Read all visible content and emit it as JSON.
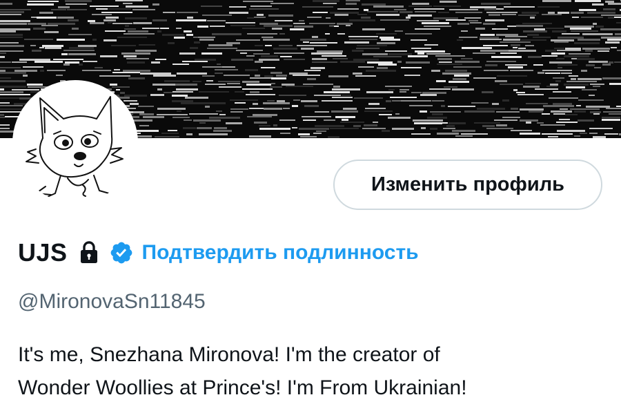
{
  "profile": {
    "display_name": "UJS",
    "verify_link_label": "Подтвердить подлинность",
    "handle": "@MironovaSn11845",
    "bio_line1": "It's me, Snezhana Mironova! I'm the creator of",
    "bio_line2": "Wonder Woollies at Prince's! I'm From Ukrainian!"
  },
  "actions": {
    "edit_profile_label": "Изменить профиль"
  },
  "icons": {
    "lock": "lock-icon",
    "verified_badge": "verified-badge-icon"
  },
  "colors": {
    "accent": "#1d9bf0",
    "text": "#0f1419",
    "muted": "#536471",
    "banner": "#0a0a0a",
    "button_border": "#cfd9de"
  }
}
